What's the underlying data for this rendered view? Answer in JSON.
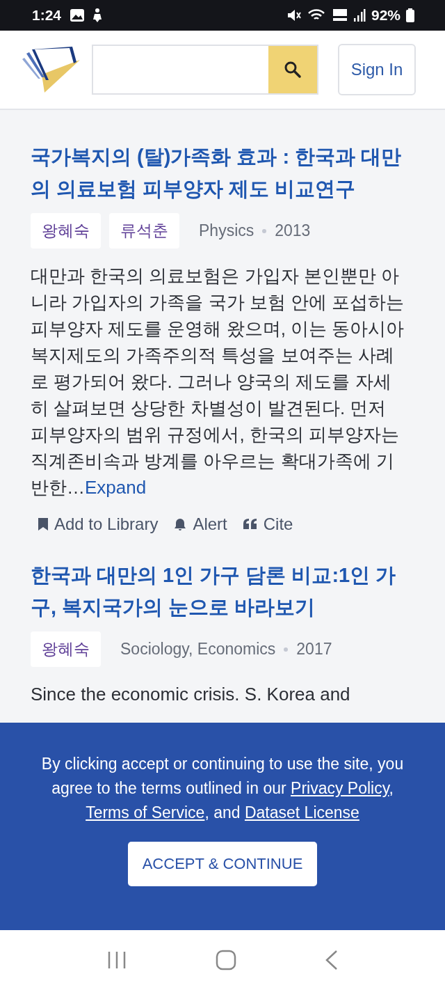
{
  "status_bar": {
    "time": "1:24",
    "battery": "92%"
  },
  "header": {
    "sign_in": "Sign In"
  },
  "papers": [
    {
      "title": "국가복지의 (탈)가족화 효과 : 한국과 대만의 의료보험 피부양자 제도 비교연구",
      "authors": [
        "왕혜숙",
        "류석춘"
      ],
      "fields": "Physics",
      "year": "2013",
      "abstract": "대만과 한국의 의료보험은 가입자 본인뿐만 아니라 가입자의 가족을 국가 보험 안에 포섭하는 피부양자 제도를 운영해 왔으며, 이는 동아시아 복지제도의 가족주의적 특성을 보여주는 사례로 평가되어 왔다. 그러나 양국의 제도를 자세히 살펴보면 상당한 차별성이 발견된다. 먼저 피부양자의 범위 규정에서, 한국의 피부양자는 직계존비속과 방계를 아우르는 확대가족에 기반한…",
      "expand": "Expand",
      "actions": [
        "Add to Library",
        "Alert",
        "Cite"
      ]
    },
    {
      "title": "한국과 대만의 1인 가구 담론 비교:1인 가구, 복지국가의 눈으로 바라보기",
      "authors": [
        "왕혜숙"
      ],
      "fields": "Sociology, Economics",
      "year": "2017",
      "abstract": "Since the economic crisis. S. Korea and"
    }
  ],
  "cookie_banner": {
    "text_before": "By clicking accept or continuing to use the site, you agree to the terms outlined in our ",
    "links": [
      "Privacy Policy",
      "Terms of Service",
      "Dataset License"
    ],
    "separators": [
      ", ",
      ", and "
    ],
    "button": "ACCEPT & CONTINUE"
  }
}
